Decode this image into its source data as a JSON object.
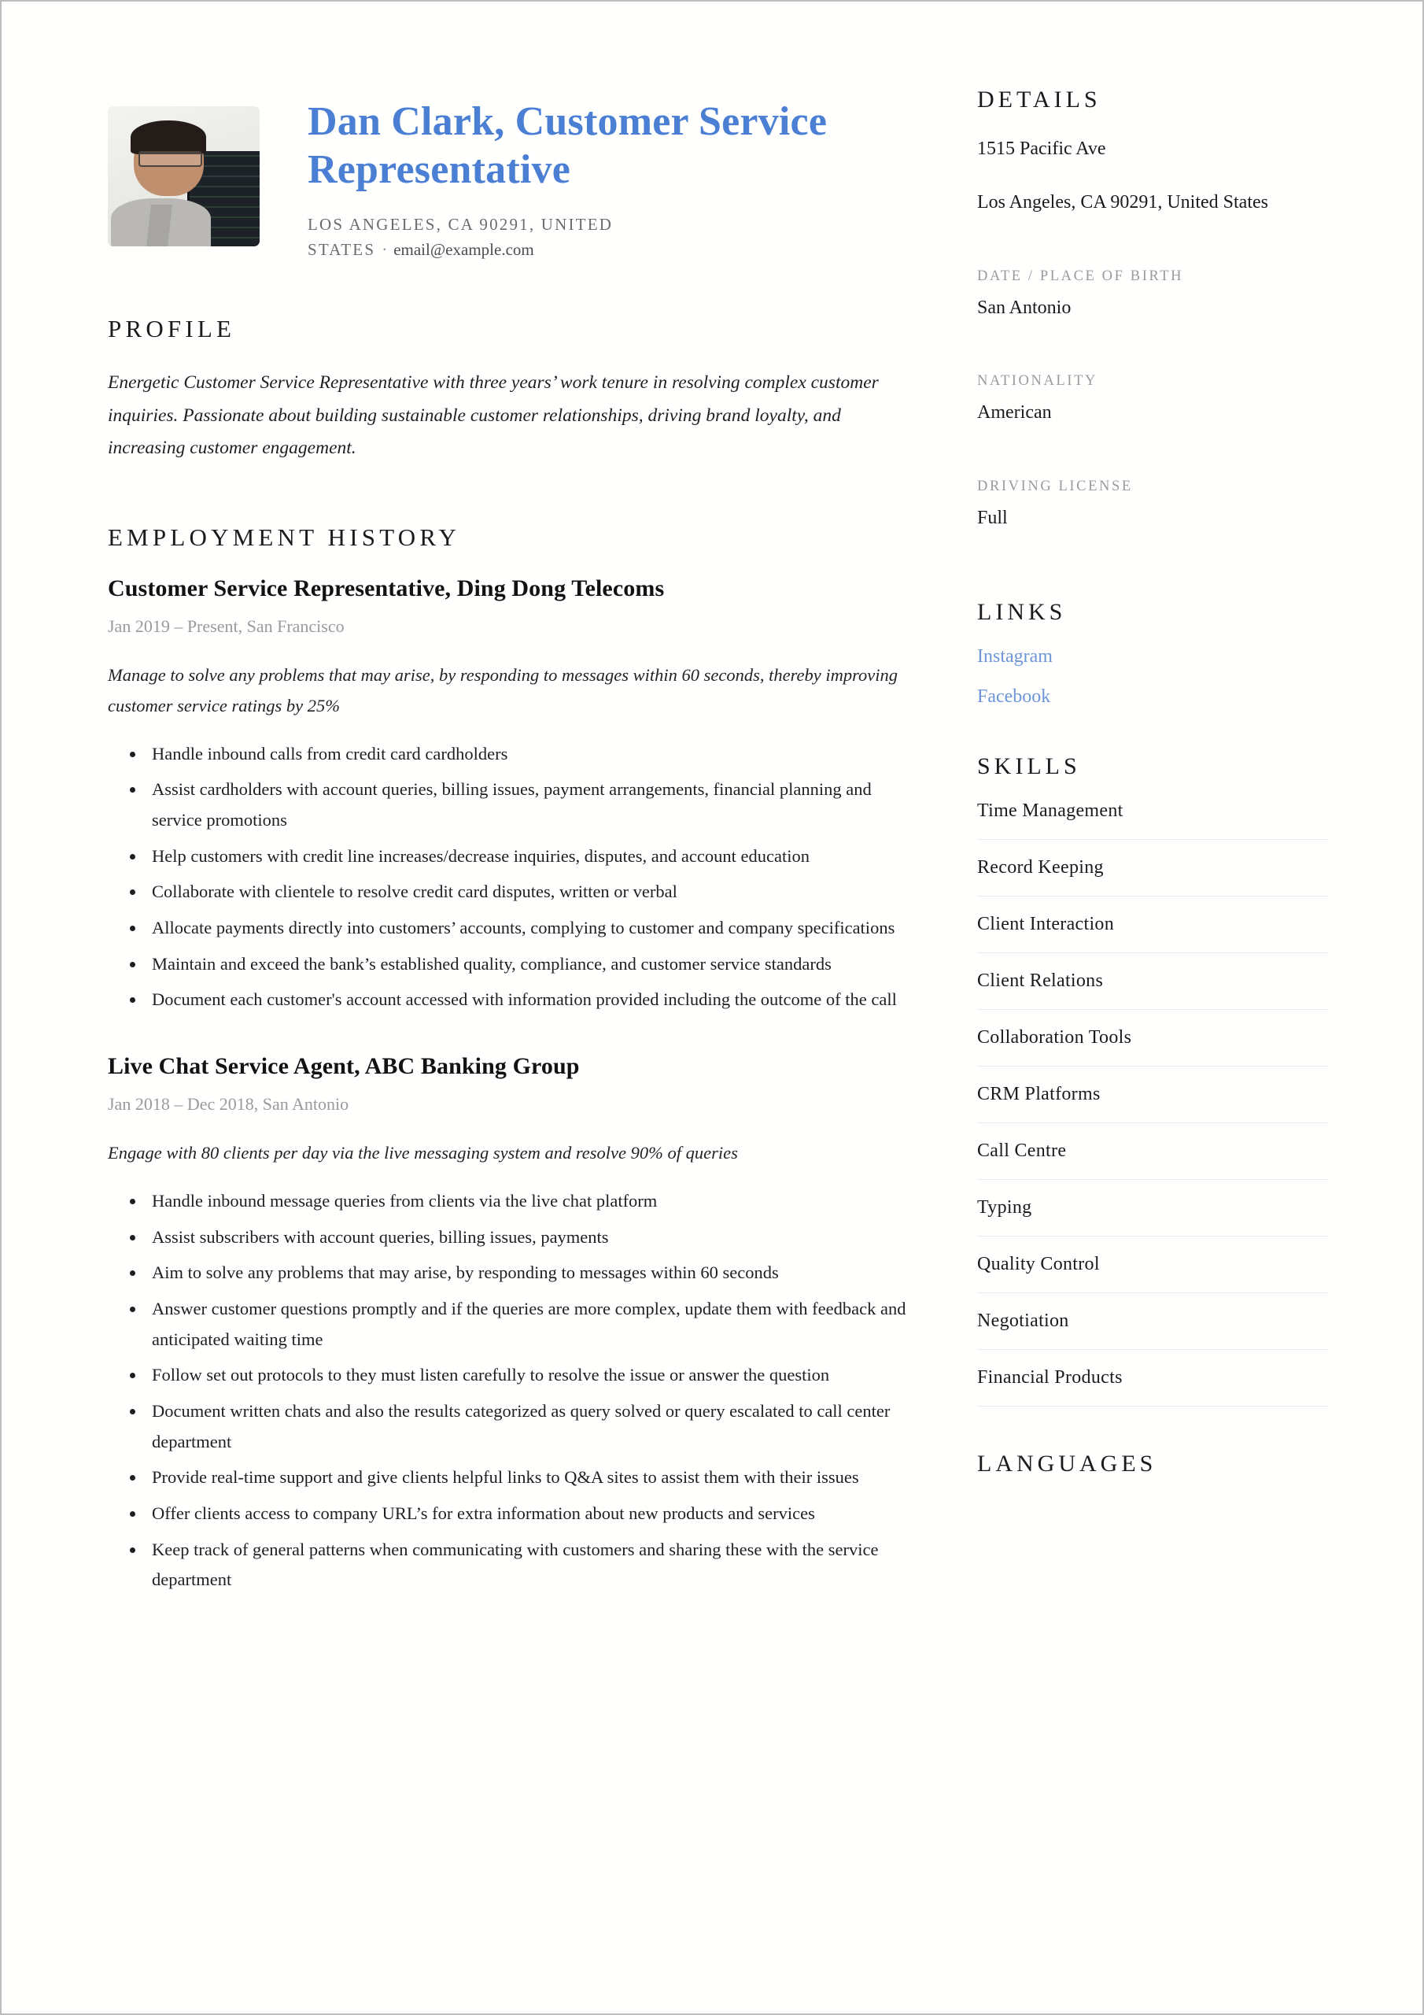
{
  "header": {
    "name_title": "Dan Clark, Customer Service Representative",
    "location": "LOS ANGELES, CA 90291, UNITED STATES",
    "separator": "·",
    "email": "email@example.com",
    "avatar_alt": "profile-photo"
  },
  "profile": {
    "heading": "PROFILE",
    "text": "Energetic Customer Service Representative with three years’ work tenure in resolving complex customer inquiries. Passionate about building sustainable customer relationships, driving brand loyalty, and increasing customer engagement."
  },
  "employment": {
    "heading": "EMPLOYMENT HISTORY",
    "jobs": [
      {
        "title": "Customer Service Representative, Ding Dong Telecoms",
        "meta": "Jan 2019 – Present, San Francisco",
        "summary": "Manage to solve any problems that may arise, by responding to messages within 60 seconds, thereby improving customer service ratings by 25%",
        "bullets": [
          "Handle inbound calls from credit card cardholders",
          "Assist cardholders with account queries, billing issues, payment arrangements, financial planning and service promotions",
          "Help customers with credit line increases/decrease inquiries, disputes, and account education",
          "Collaborate with clientele to resolve credit card disputes, written or verbal",
          "Allocate payments directly into customers’ accounts, complying to customer and company specifications",
          "Maintain and exceed the bank’s established quality, compliance, and customer service standards",
          "Document each customer's account accessed with information provided including the outcome of the call"
        ]
      },
      {
        "title": "Live Chat Service Agent, ABC Banking Group",
        "meta": "Jan 2018 – Dec 2018, San Antonio",
        "summary": "Engage with 80 clients per day via the live messaging system and resolve 90% of queries",
        "bullets": [
          "Handle inbound message queries from clients via the live chat platform",
          "Assist subscribers with account queries, billing issues, payments",
          "Aim to solve any problems that may arise, by responding to messages within 60 seconds",
          "Answer customer questions promptly and if the queries are more complex, update them with feedback and anticipated waiting time",
          "Follow set out protocols to they must listen carefully to resolve the issue or answer the question",
          "Document written chats and also the results categorized as query solved or query escalated to call center department",
          "Provide real-time support and give clients helpful links to Q&A sites to assist them with their issues",
          "Offer clients access to company URL’s for extra information about new products and services",
          "Keep track of general patterns when communicating with customers and sharing these with the service department"
        ]
      }
    ]
  },
  "sidebar": {
    "details": {
      "heading": "DETAILS",
      "address_line1": "1515 Pacific Ave",
      "address_line2": "Los Angeles, CA 90291, United States",
      "birth_label": "DATE / PLACE OF BIRTH",
      "birth_value": "San Antonio",
      "nationality_label": "NATIONALITY",
      "nationality_value": "American",
      "license_label": "DRIVING LICENSE",
      "license_value": "Full"
    },
    "links": {
      "heading": "LINKS",
      "items": [
        "Instagram",
        "Facebook"
      ]
    },
    "skills": {
      "heading": "SKILLS",
      "items": [
        "Time Management",
        "Record Keeping",
        "Client Interaction",
        "Client Relations",
        "Collaboration Tools",
        "CRM Platforms",
        "Call Centre",
        "Typing",
        "Quality Control",
        "Negotiation",
        "Financial Products"
      ]
    },
    "languages": {
      "heading": "LANGUAGES"
    }
  },
  "colors": {
    "accent_blue": "#4a7fd4",
    "link_blue": "#6d96d8",
    "muted_gray": "#9a9a9a",
    "text": "#1b1b1b",
    "divider": "#ececec",
    "page_border": "#bdbdbd"
  }
}
